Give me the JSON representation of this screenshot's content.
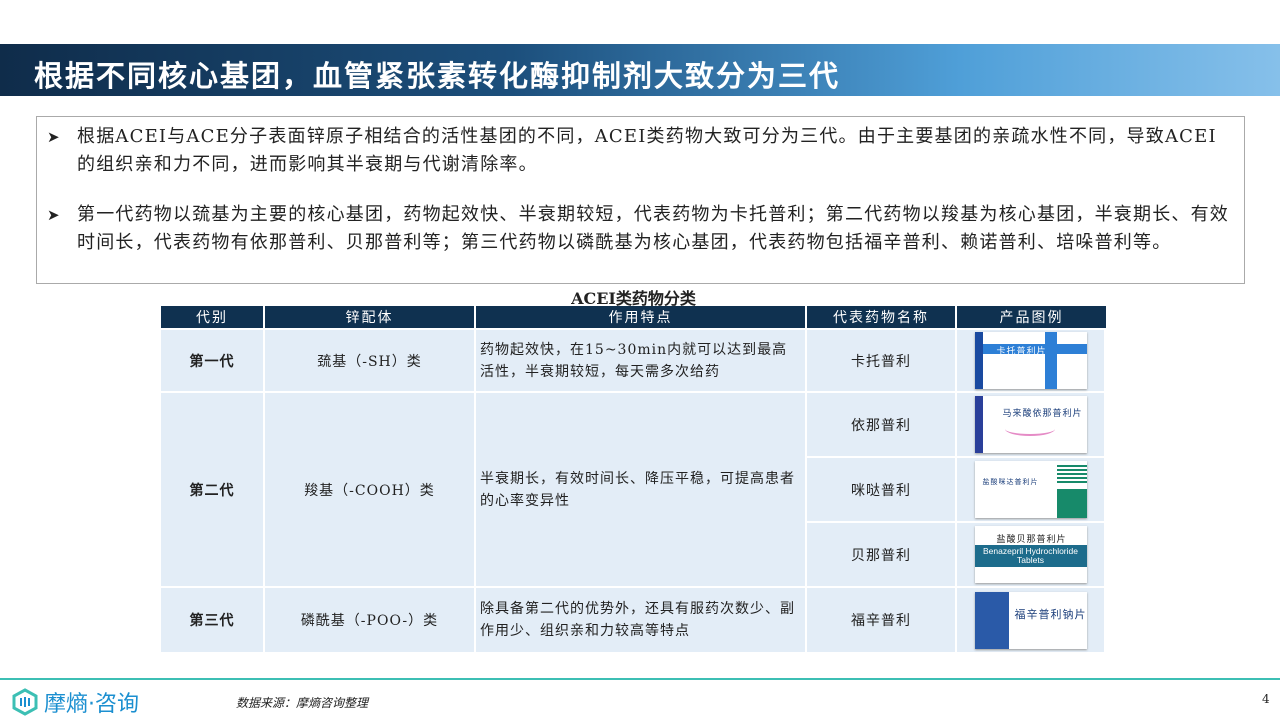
{
  "header": {
    "title": "根据不同核心基团，血管紧张素转化酶抑制剂大致分为三代"
  },
  "bullets": [
    "根据ACEI与ACE分子表面锌原子相结合的活性基团的不同，ACEI类药物大致可分为三代。由于主要基团的亲疏水性不同，导致ACEI的组织亲和力不同，进而影响其半衰期与代谢清除率。",
    "第一代药物以巯基为主要的核心基团，药物起效快、半衰期较短，代表药物为卡托普利；第二代药物以羧基为核心基团，半衰期长、有效时间长，代表药物有依那普利、贝那普利等；第三代药物以磷酰基为核心基团，代表药物包括福辛普利、赖诺普利、培哚普利等。"
  ],
  "table": {
    "title": "ACEI类药物分类",
    "headers": [
      "代别",
      "锌配体",
      "作用特点",
      "代表药物名称",
      "产品图例"
    ],
    "rows": [
      {
        "gen": "第一代",
        "ligand": "巯基（-SH）类",
        "feature": "药物起效快，在15~30min内就可以达到最高活性，半衰期较短，每天需多次给药",
        "drugs": [
          {
            "name": "卡托普利",
            "pack": "卡托普利片"
          }
        ]
      },
      {
        "gen": "第二代",
        "ligand": "羧基（-COOH）类",
        "feature": "半衰期长，有效时间长、降压平稳，可提高患者的心率变异性",
        "drugs": [
          {
            "name": "依那普利",
            "pack": "马来酸依那普利片"
          },
          {
            "name": "咪哒普利",
            "pack": "盐酸咪达普利片"
          },
          {
            "name": "贝那普利",
            "pack": "盐酸贝那普利片",
            "pack_en": "Benazepril Hydrochloride Tablets"
          }
        ]
      },
      {
        "gen": "第三代",
        "ligand": "磷酰基（-POO-）类",
        "feature": "除具备第二代的优势外，还具有服药次数少、副作用少、组织亲和力较高等特点",
        "drugs": [
          {
            "name": "福辛普利",
            "pack": "福辛普利钠片"
          }
        ]
      }
    ]
  },
  "footer": {
    "logo": "摩熵·咨询",
    "source": "数据来源：摩熵咨询整理",
    "page": "4"
  },
  "colors": {
    "header_dark": "#0f2c4a",
    "table_head": "#0f3150",
    "row_bg": "#e3edf7",
    "accent": "#3cbfb4"
  }
}
